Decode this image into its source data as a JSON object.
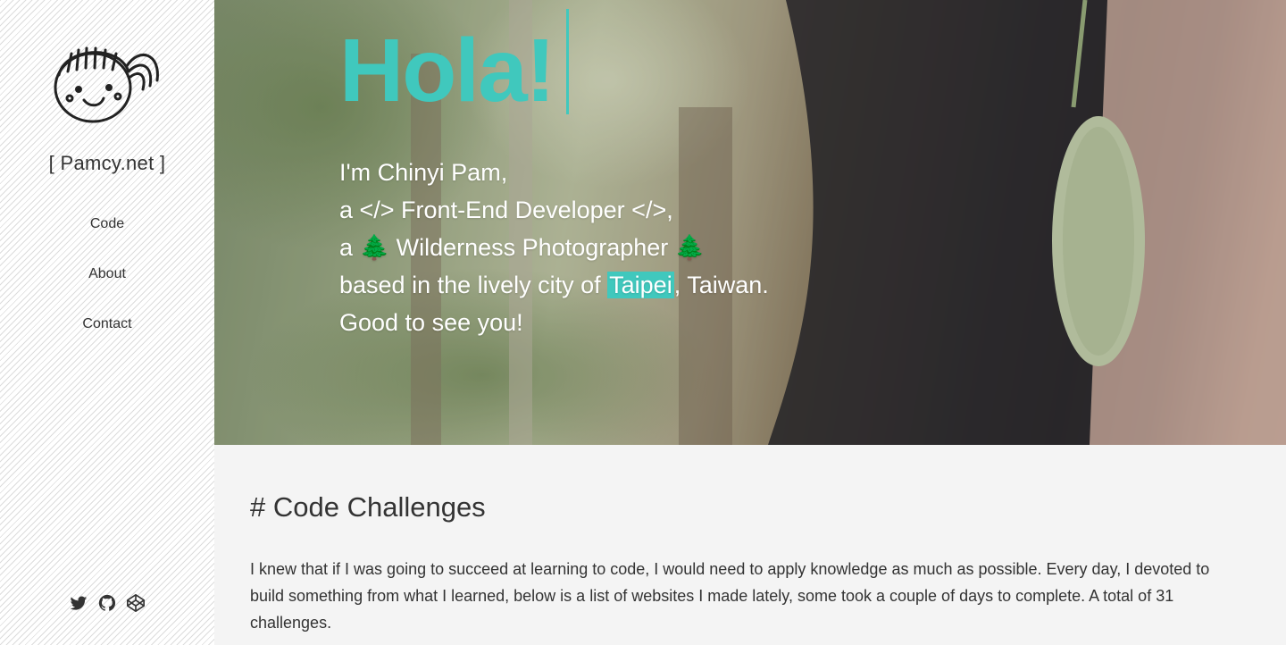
{
  "sidebar": {
    "brand": "[ Pamcy.net ]",
    "nav": [
      {
        "label": "Code"
      },
      {
        "label": "About"
      },
      {
        "label": "Contact"
      }
    ],
    "social": [
      {
        "icon": "twitter-icon"
      },
      {
        "icon": "github-icon"
      },
      {
        "icon": "codepen-icon"
      }
    ]
  },
  "hero": {
    "greeting": "Hola!",
    "lines": [
      "I'm Chinyi Pam,",
      "a </> Front-End Developer </>,",
      "a 🌲 Wilderness Photographer 🌲",
      "based in the lively city of ",
      "Good to see you!"
    ],
    "city": "Taipei",
    "city_suffix": ", Taiwan."
  },
  "content": {
    "title": "# Code Challenges",
    "paragraph": "I knew that if I was going to succeed at learning to code, I would need to apply knowledge as much as possible. Every day, I devoted to build something from what I learned, below is a list of websites I made lately, some took a couple of days to complete. A total of 31 challenges."
  },
  "colors": {
    "accent": "#40c8bd",
    "text": "#333333",
    "background": "#f4f4f4"
  }
}
